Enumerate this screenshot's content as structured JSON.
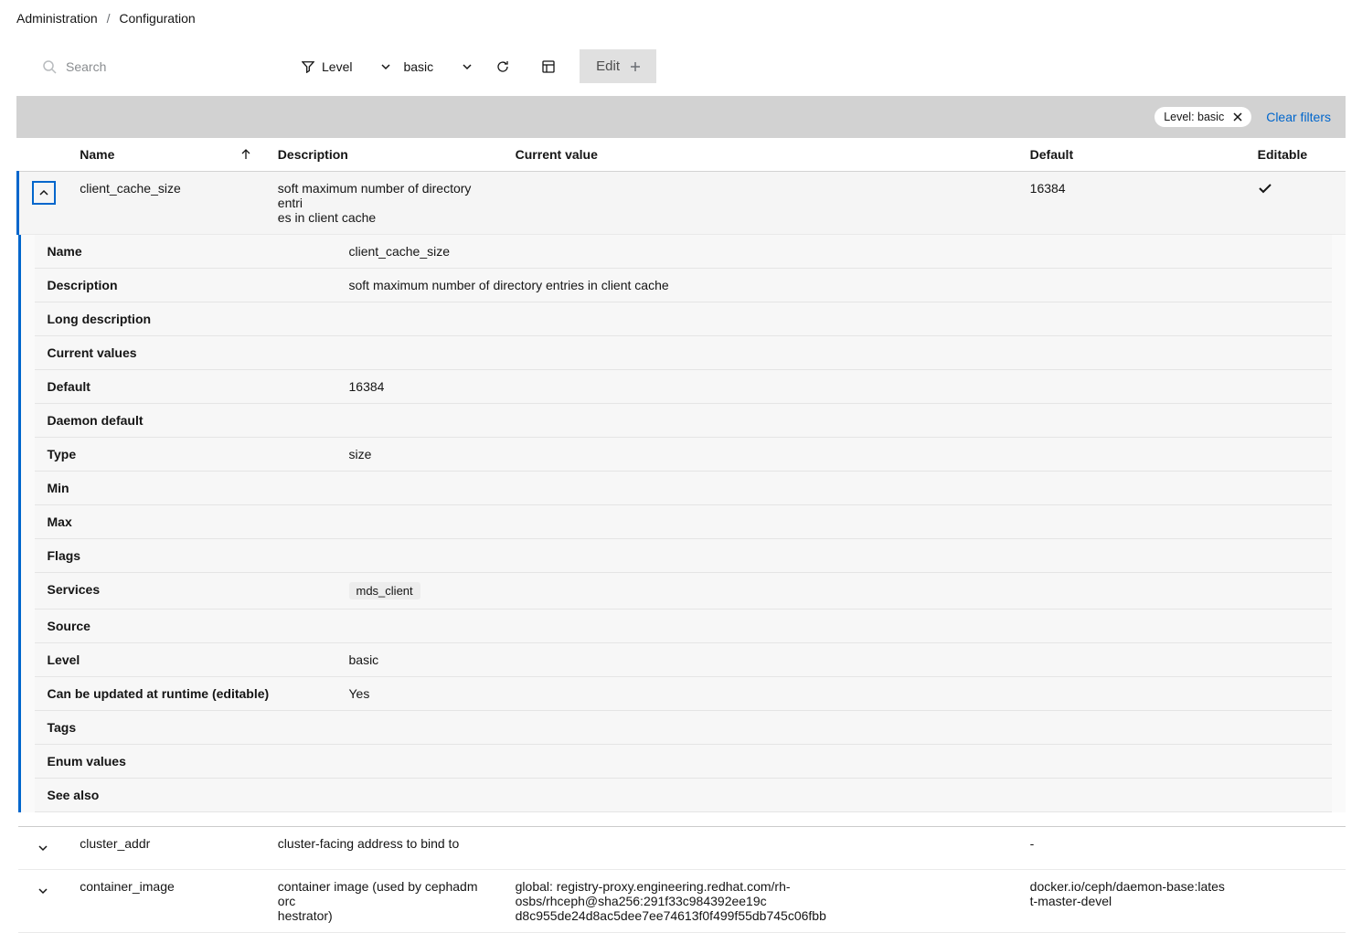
{
  "breadcrumb": {
    "parent": "Administration",
    "current": "Configuration"
  },
  "toolbar": {
    "search_placeholder": "Search",
    "level_label": "Level",
    "level_value": "basic",
    "edit_label": "Edit"
  },
  "filter_bar": {
    "chip_text": "Level: basic",
    "clear_filters": "Clear filters"
  },
  "columns": {
    "name": "Name",
    "description": "Description",
    "current_value": "Current value",
    "default": "Default",
    "editable": "Editable"
  },
  "rows": [
    {
      "name": "client_cache_size",
      "description": "soft maximum number of directory entries in client cache",
      "description_wrapped_l1": "soft maximum number of directory entri",
      "description_wrapped_l2": "es in client cache",
      "current_value": "",
      "default": "16384",
      "editable_check": true,
      "expanded": true,
      "details": {
        "Name": "client_cache_size",
        "Description": "soft maximum number of directory entries in client cache",
        "Long description": "",
        "Current values": "",
        "Default": "16384",
        "Daemon default": "",
        "Type": "size",
        "Min": "",
        "Max": "",
        "Flags": "",
        "Services": "mds_client",
        "Source": "",
        "Level": "basic",
        "Can be updated at runtime (editable)": "Yes",
        "Tags": "",
        "Enum values": "",
        "See also": ""
      }
    },
    {
      "name": "cluster_addr",
      "description": "cluster-facing address to bind to",
      "current_value": "",
      "default": "-",
      "editable_check": false,
      "expanded": false
    },
    {
      "name": "container_image",
      "description_wrapped_l1": "container image (used by cephadm orc",
      "description_wrapped_l2": "hestrator)",
      "current_value_l1": "global: registry-proxy.engineering.redhat.com/rh-osbs/rhceph@sha256:291f33c984392ee19c",
      "current_value_l2": "d8c955de24d8ac5dee7ee74613f0f499f55db745c06fbb",
      "default_l1": "docker.io/ceph/daemon-base:lates",
      "default_l2": "t-master-devel",
      "editable_check": false,
      "expanded": false
    }
  ],
  "detail_keys": {
    "name": "Name",
    "description": "Description",
    "long_description": "Long description",
    "current_values": "Current values",
    "default": "Default",
    "daemon_default": "Daemon default",
    "type": "Type",
    "min": "Min",
    "max": "Max",
    "flags": "Flags",
    "services": "Services",
    "source": "Source",
    "level": "Level",
    "editable": "Can be updated at runtime (editable)",
    "tags": "Tags",
    "enum_values": "Enum values",
    "see_also": "See also"
  }
}
